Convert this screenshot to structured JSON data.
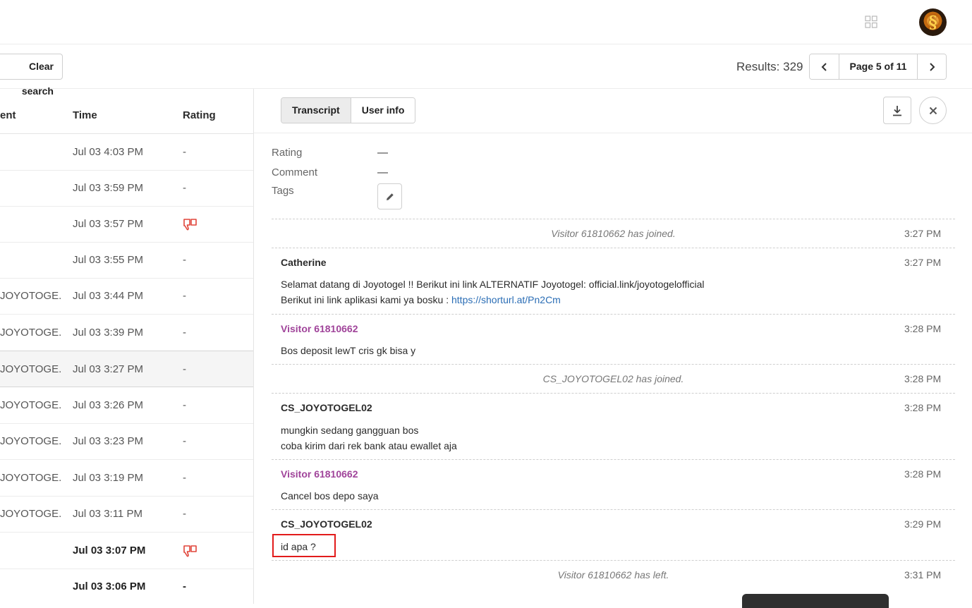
{
  "toolbar": {
    "clear_search": "Clear search",
    "results": "Results: 329",
    "page_label": "Page 5 of 11"
  },
  "list": {
    "columns": {
      "agent": "ent",
      "time": "Time",
      "rating": "Rating"
    },
    "rows": [
      {
        "agent": "",
        "time": "Jul 03 4:03 PM",
        "rating": "-"
      },
      {
        "agent": "",
        "time": "Jul 03 3:59 PM",
        "rating": "-"
      },
      {
        "agent": "",
        "time": "Jul 03 3:57 PM",
        "rating": "thumbs-down-icon"
      },
      {
        "agent": "",
        "time": "Jul 03 3:55 PM",
        "rating": "-"
      },
      {
        "agent": "JOYOTOGE...",
        "time": "Jul 03 3:44 PM",
        "rating": "-"
      },
      {
        "agent": "JOYOTOGE...",
        "time": "Jul 03 3:39 PM",
        "rating": "-"
      },
      {
        "agent": "JOYOTOGE...",
        "time": "Jul 03 3:27 PM",
        "rating": "-"
      },
      {
        "agent": "JOYOTOGE...",
        "time": "Jul 03 3:26 PM",
        "rating": "-"
      },
      {
        "agent": "JOYOTOGE...",
        "time": "Jul 03 3:23 PM",
        "rating": "-"
      },
      {
        "agent": "JOYOTOGE...",
        "time": "Jul 03 3:19 PM",
        "rating": "-"
      },
      {
        "agent": "JOYOTOGE...",
        "time": "Jul 03 3:11 PM",
        "rating": "-"
      },
      {
        "agent": "",
        "time": "Jul 03 3:07 PM",
        "rating": "thumbs-down-icon"
      },
      {
        "agent": "",
        "time": "Jul 03 3:06 PM",
        "rating": "-"
      }
    ]
  },
  "detail": {
    "tabs": {
      "transcript": "Transcript",
      "user_info": "User info"
    },
    "meta": {
      "rating_label": "Rating",
      "rating_value": "—",
      "comment_label": "Comment",
      "comment_value": "—",
      "tags_label": "Tags"
    },
    "transcript": {
      "e1": {
        "text": "Visitor 61810662 has joined.",
        "time": "3:27 PM"
      },
      "e2": {
        "author": "Catherine",
        "time": "3:27 PM",
        "line1": "Selamat datang di Joyotogel !! Berikut ini link ALTERNATIF Joyotogel: official.link/joyotogelofficial",
        "line2": "Berikut ini link aplikasi kami ya bosku : ",
        "link": "https://shorturl.at/Pn2Cm"
      },
      "e3": {
        "author": "Visitor 61810662",
        "time": "3:28 PM",
        "line1": "Bos deposit lewT cris gk bisa y"
      },
      "e4": {
        "text": "CS_JOYOTOGEL02 has joined.",
        "time": "3:28 PM"
      },
      "e5": {
        "author": "CS_JOYOTOGEL02",
        "time": "3:28 PM",
        "line1": "mungkin sedang gangguan bos",
        "line2": "coba kirim dari rek bank atau ewallet aja"
      },
      "e6": {
        "author": "Visitor 61810662",
        "time": "3:28 PM",
        "line1": "Cancel bos depo saya"
      },
      "e7": {
        "author": "CS_JOYOTOGEL02",
        "time": "3:29 PM",
        "line1": "id apa ?"
      },
      "e8": {
        "text": "Visitor 61810662 has left.",
        "time": "3:31 PM"
      }
    }
  },
  "icons": {
    "apps": "apps-grid-icon",
    "avatar": "avatar",
    "prev": "chevron-left-icon",
    "next": "chevron-right-icon",
    "download": "download-icon",
    "close": "close-icon",
    "edit": "pencil-icon",
    "thumbs_down": "thumbs-down-icon"
  },
  "colors": {
    "visitor_name": "#a0449a",
    "link": "#2a6db5",
    "thumb_down": "#e0453a",
    "highlight": "#e21b1b"
  }
}
